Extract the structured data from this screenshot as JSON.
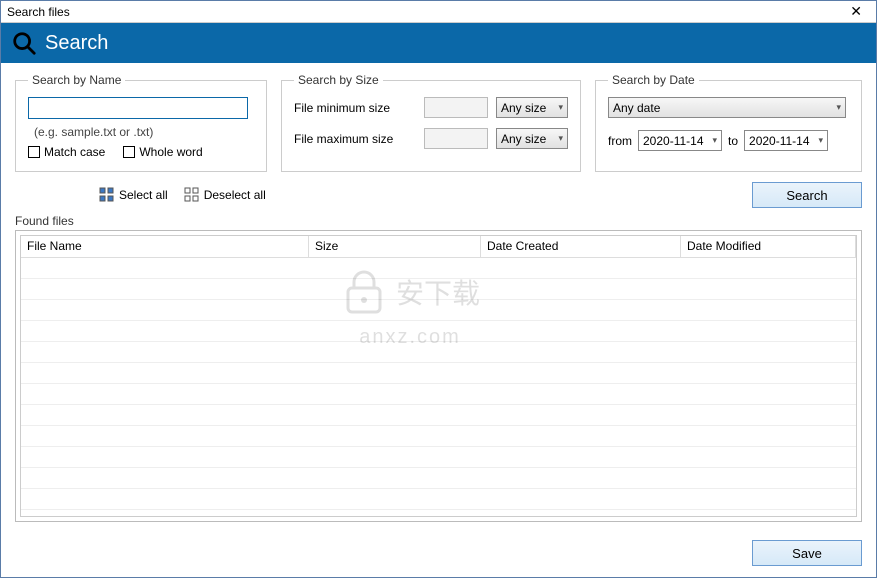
{
  "window": {
    "title": "Search files"
  },
  "header": {
    "title": "Search"
  },
  "searchByName": {
    "legend": "Search by Name",
    "value": "",
    "hint": "(e.g. sample.txt or .txt)",
    "matchCase": "Match case",
    "wholeWord": "Whole word"
  },
  "searchBySize": {
    "legend": "Search by Size",
    "minLabel": "File minimum size",
    "maxLabel": "File maximum size",
    "minValue": "",
    "maxValue": "",
    "unit": "Any size"
  },
  "searchByDate": {
    "legend": "Search by Date",
    "mode": "Any date",
    "fromLabel": "from",
    "fromValue": "2020-11-14",
    "toLabel": "to",
    "toValue": "2020-11-14"
  },
  "actions": {
    "selectAll": "Select all",
    "deselectAll": "Deselect all",
    "search": "Search",
    "save": "Save"
  },
  "found": {
    "label": "Found files",
    "columns": {
      "name": "File Name",
      "size": "Size",
      "created": "Date Created",
      "modified": "Date Modified"
    },
    "rows": []
  },
  "watermark": {
    "cn": "安下载",
    "url": "anxz.com"
  }
}
